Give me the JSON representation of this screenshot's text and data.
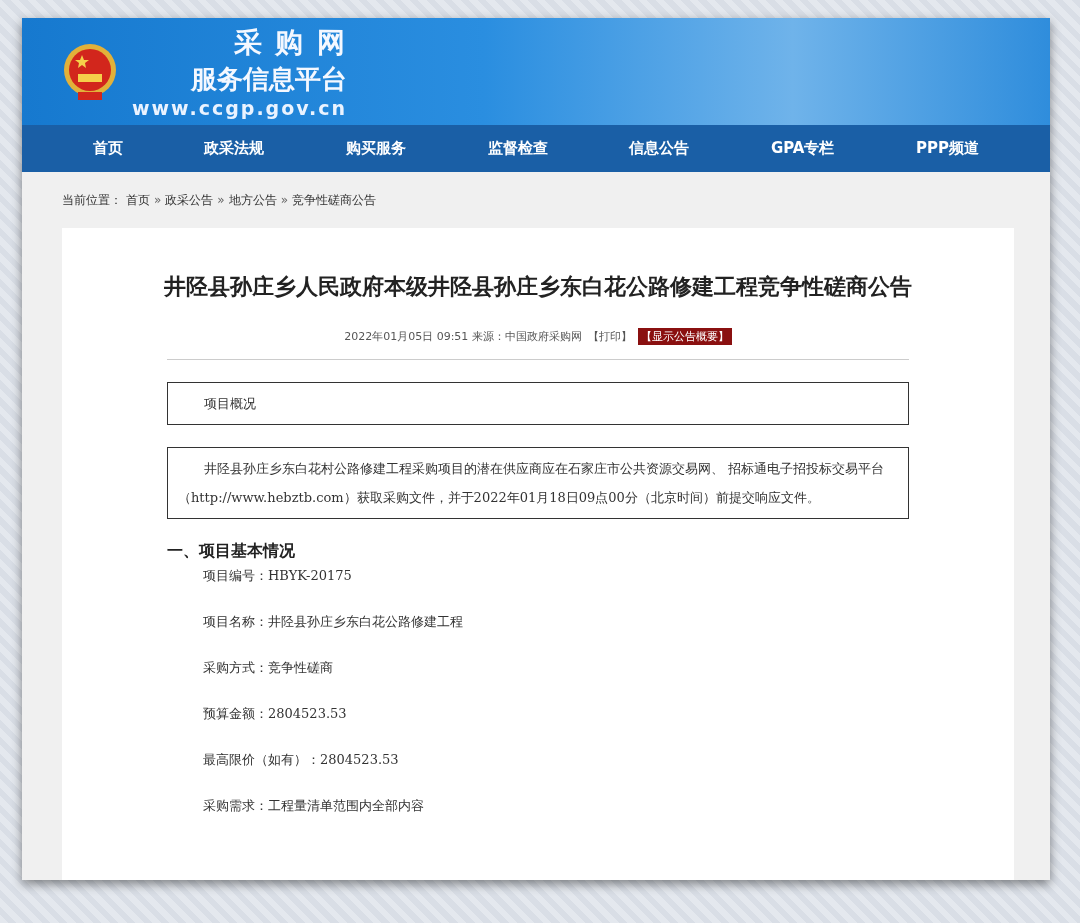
{
  "header": {
    "site_name": "采 购 网",
    "subtitle": "服务信息平台",
    "url": "www.ccgp.gov.cn"
  },
  "nav": [
    {
      "label": "首页",
      "selected": false
    },
    {
      "label": "政采法规",
      "selected": false
    },
    {
      "label": "购买服务",
      "selected": false
    },
    {
      "label": "监督检查",
      "selected": false
    },
    {
      "label": "信息公告",
      "selected": false
    },
    {
      "label": "GPA专栏",
      "selected": false
    },
    {
      "label": "PPP频道",
      "selected": false
    }
  ],
  "breadcrumb": {
    "prefix": "当前位置：",
    "separator": "»",
    "items": [
      "首页",
      "政采公告",
      "地方公告",
      "竞争性磋商公告"
    ]
  },
  "article": {
    "title": "井陉县孙庄乡人民政府本级井陉县孙庄乡东白花公路修建工程竞争性磋商公告",
    "meta": "2022年01月05日 09:51 来源：中国政府采购网",
    "print_link": "【打印】",
    "summary_button": "【显示公告概要】",
    "overview_heading": "项目概况",
    "overview_text": "井陉县孙庄乡东白花村公路修建工程采购项目的潜在供应商应在石家庄市公共资源交易网、 招标通电子招投标交易平台（http://www.hebztb.com）获取采购文件，并于2022年01月18日09点00分（北京时间）前提交响应文件。",
    "section_heading": "一、项目基本情况",
    "fields": [
      "项目编号：HBYK-20175",
      "项目名称：井陉县孙庄乡东白花公路修建工程",
      "采购方式：竞争性磋商",
      "预算金额：2804523.53",
      "最高限价（如有）：2804523.53",
      "采购需求：工程量清单范围内全部内容"
    ]
  }
}
